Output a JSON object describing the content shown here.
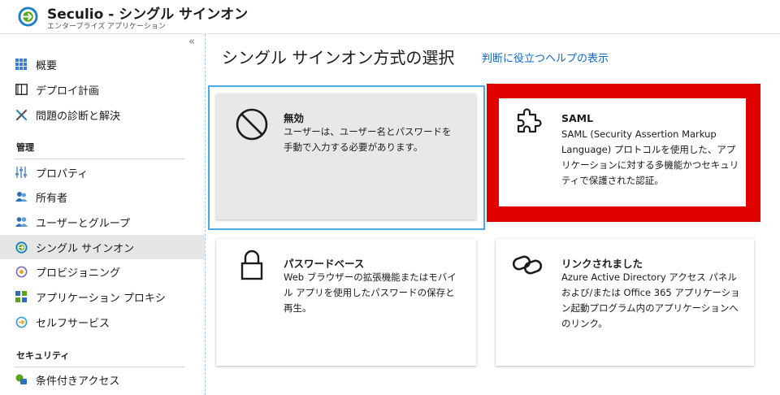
{
  "header": {
    "title": "Seculio - シングル サインオン",
    "subtitle": "エンタープライズ アプリケーション"
  },
  "sidebar": {
    "collapse_label": "«",
    "items": [
      {
        "label": "概要",
        "icon": "grid-icon"
      },
      {
        "label": "デプロイ計画",
        "icon": "book-icon"
      },
      {
        "label": "問題の診断と解決",
        "icon": "tools-icon"
      }
    ],
    "sections": [
      {
        "label": "管理"
      },
      {
        "label": "セキュリティ"
      }
    ],
    "manage_items": [
      {
        "label": "プロパティ",
        "icon": "sliders-icon"
      },
      {
        "label": "所有者",
        "icon": "people-icon"
      },
      {
        "label": "ユーザーとグループ",
        "icon": "users-groups-icon"
      },
      {
        "label": "シングル サインオン",
        "icon": "sso-icon",
        "active": true
      },
      {
        "label": "プロビジョニング",
        "icon": "provisioning-icon"
      },
      {
        "label": "アプリケーション プロキシ",
        "icon": "app-proxy-icon"
      },
      {
        "label": "セルフサービス",
        "icon": "self-service-icon"
      }
    ],
    "security_items": [
      {
        "label": "条件付きアクセス",
        "icon": "conditional-access-icon"
      }
    ]
  },
  "main": {
    "title": "シングル サインオン方式の選択",
    "help_link": "判断に役立つヘルプの表示",
    "cards": [
      {
        "title": "無効",
        "description": "ユーザーは、ユーザー名とパスワードを手動で入力する必要があります。",
        "icon": "disabled-icon",
        "state": "selected"
      },
      {
        "title": "SAML",
        "description": "SAML (Security Assertion Markup Language) プロトコルを使用した、アプリケーションに対する多機能かつセキュリティで保護された認証。",
        "icon": "puzzle-icon",
        "state": "highlighted"
      },
      {
        "title": "パスワードベース",
        "description": "Web ブラウザーの拡張機能またはモバイル アプリを使用したパスワードの保存と再生。",
        "icon": "lock-icon",
        "state": "normal"
      },
      {
        "title": "リンクされました",
        "description": "Azure Active Directory アクセス パネルおよび/または Office 365 アプリケーション起動プログラム内のアプリケーションへのリンク。",
        "icon": "link-icon",
        "state": "normal"
      }
    ]
  },
  "colors": {
    "accent": "#0b6ac9",
    "selected_border": "#4fa8e0",
    "highlight_frame": "#e00000",
    "active_nav_bg": "#e6e6e6",
    "disabled_card_bg": "#e8e8e8"
  }
}
